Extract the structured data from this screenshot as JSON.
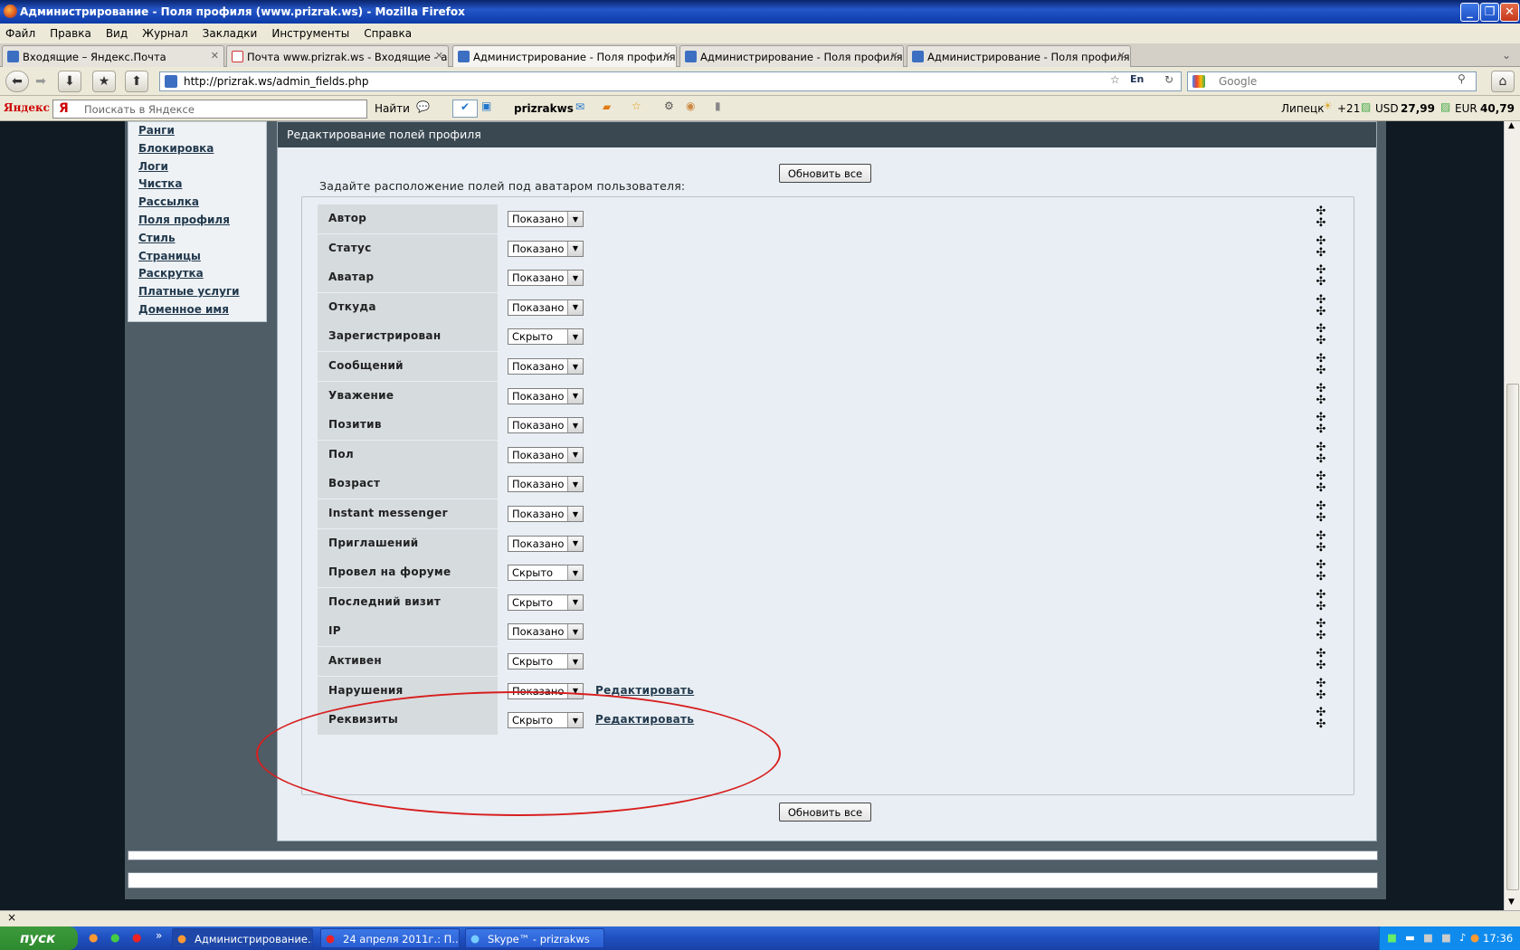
{
  "window": {
    "title": "Администрирование - Поля профиля (www.prizrak.ws) - Mozilla Firefox"
  },
  "menu": [
    "Файл",
    "Правка",
    "Вид",
    "Журнал",
    "Закладки",
    "Инструменты",
    "Справка"
  ],
  "tabs": [
    {
      "label": "Входящие – Яндекс.Почта"
    },
    {
      "label": "Почта www.prizrak.ws - Входящие - admi..."
    },
    {
      "label": "Администрирование - Поля профиля (w..."
    },
    {
      "label": "Администрирование - Поля профиля (w..."
    },
    {
      "label": "Администрирование - Поля профиля (w..."
    }
  ],
  "nav": {
    "url": "http://prizrak.ws/admin_fields.php",
    "search_placeholder": "Google",
    "lang": "En"
  },
  "yandex": {
    "logo": "Яндекс",
    "search_placeholder": "Поискать в Яндексе",
    "find": "Найти",
    "user": "prizrakws",
    "city": "Липецк",
    "temp": "+21",
    "usd_label": "USD",
    "usd": "27,99",
    "eur_label": "EUR",
    "eur": "40,79"
  },
  "sidebar": [
    "Ранги",
    "Блокировка",
    "Логи",
    "Чистка",
    "Рассылка",
    "Поля профиля",
    "Стиль",
    "Страницы",
    "Раскрутка",
    "Платные услуги",
    "Доменное имя"
  ],
  "panel": {
    "title": "Редактирование полей профиля",
    "update_all": "Обновить все",
    "legend": "Задайте расположение полей под аватаром пользователя:",
    "edit_label": "Редактировать"
  },
  "fields": [
    {
      "label": "Автор",
      "value": "Показано",
      "editable": false
    },
    {
      "label": "Статус",
      "value": "Показано",
      "editable": false
    },
    {
      "label": "Аватар",
      "value": "Показано",
      "editable": false
    },
    {
      "label": "Откуда",
      "value": "Показано",
      "editable": false
    },
    {
      "label": "Зарегистрирован",
      "value": "Скрыто",
      "editable": false
    },
    {
      "label": "Сообщений",
      "value": "Показано",
      "editable": false
    },
    {
      "label": "Уважение",
      "value": "Показано",
      "editable": false
    },
    {
      "label": "Позитив",
      "value": "Показано",
      "editable": false
    },
    {
      "label": "Пол",
      "value": "Показано",
      "editable": false
    },
    {
      "label": "Возраст",
      "value": "Показано",
      "editable": false
    },
    {
      "label": "Instant messenger",
      "value": "Показано",
      "editable": false
    },
    {
      "label": "Приглашений",
      "value": "Показано",
      "editable": false
    },
    {
      "label": "Провел на форуме",
      "value": "Скрыто",
      "editable": false
    },
    {
      "label": "Последний визит",
      "value": "Скрыто",
      "editable": false
    },
    {
      "label": "IP",
      "value": "Показано",
      "editable": false
    },
    {
      "label": "Активен",
      "value": "Скрыто",
      "editable": false
    },
    {
      "label": "Нарушения",
      "value": "Показано",
      "editable": true
    },
    {
      "label": "Реквизиты",
      "value": "Скрыто",
      "editable": true
    }
  ],
  "status": {
    "close": "×"
  },
  "taskbar": {
    "start": "пуск",
    "tasks": [
      "Администрирование...",
      "24 апреля 2011г.: П...",
      "Skype™ - prizrakws"
    ],
    "clock": "17:36"
  }
}
